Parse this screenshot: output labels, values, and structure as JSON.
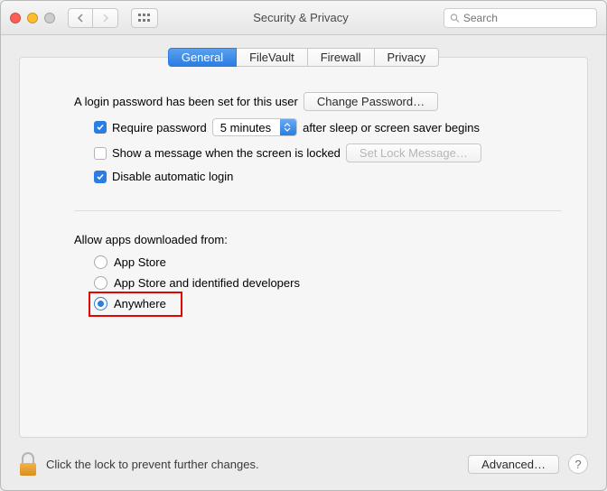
{
  "titlebar": {
    "title": "Security & Privacy",
    "search_placeholder": "Search"
  },
  "tabs": {
    "general": "General",
    "filevault": "FileVault",
    "firewall": "Firewall",
    "privacy": "Privacy",
    "active": "general"
  },
  "login": {
    "intro": "A login password has been set for this user",
    "change_password": "Change Password…",
    "require_prefix": "Require password",
    "require_select": "5 minutes",
    "require_suffix": "after sleep or screen saver begins",
    "show_message": "Show a message when the screen is locked",
    "set_lock_message": "Set Lock Message…",
    "disable_auto_login": "Disable automatic login"
  },
  "gatekeeper": {
    "label": "Allow apps downloaded from:",
    "opt_appstore": "App Store",
    "opt_identified": "App Store and identified developers",
    "opt_anywhere": "Anywhere",
    "selected": "anywhere"
  },
  "footer": {
    "lock_text": "Click the lock to prevent further changes.",
    "advanced": "Advanced…"
  }
}
